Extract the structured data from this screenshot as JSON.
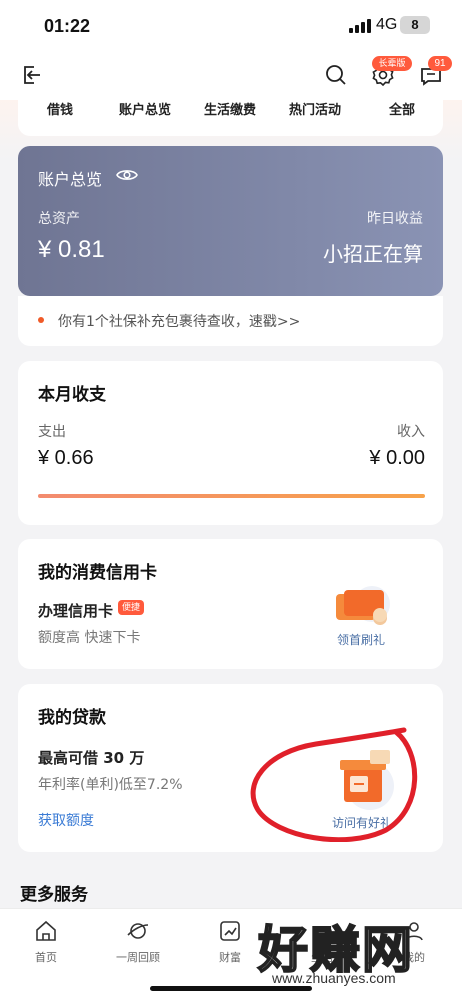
{
  "status_bar": {
    "time": "01:22",
    "network": "4G",
    "battery": "8"
  },
  "top_nav": {
    "badge_label": "长辈版",
    "message_count": "91"
  },
  "quick_nav": {
    "items": [
      "借钱",
      "账户总览",
      "生活缴费",
      "热门活动",
      "全部"
    ]
  },
  "account": {
    "title": "账户总览",
    "total_assets_label": "总资产",
    "total_assets_value": "¥ 0.81",
    "yesterday_label": "昨日收益",
    "yesterday_value": "小招正在算"
  },
  "notice": {
    "text": "你有1个社保补充包裹待查收，速戳>>"
  },
  "monthly": {
    "title": "本月收支",
    "expense_label": "支出",
    "expense_value": "¥ 0.66",
    "income_label": "收入",
    "income_value": "¥ 0.00"
  },
  "credit_card": {
    "title": "我的消费信用卡",
    "apply_label": "办理信用卡",
    "apply_tag": "便捷",
    "desc": "额度高 快速下卡",
    "promo_label": "领首刷礼"
  },
  "loan": {
    "title": "我的贷款",
    "max_label": "最高可借 30 万",
    "rate_label": "年利率(单利)低至7.2%",
    "action_label": "获取额度",
    "promo_label": "访问有好礼"
  },
  "more_services": {
    "title": "更多服务"
  },
  "tab_bar": {
    "tabs": [
      "首页",
      "一周回顾",
      "财富",
      "生活",
      "我的"
    ]
  },
  "watermark": {
    "text": "好赚网",
    "url": "www.zhuanyes.com"
  },
  "colors": {
    "accent": "#f05a28",
    "card_gradient_start": "#6f7593",
    "card_gradient_end": "#8a93b4",
    "link": "#3a7bd5"
  }
}
